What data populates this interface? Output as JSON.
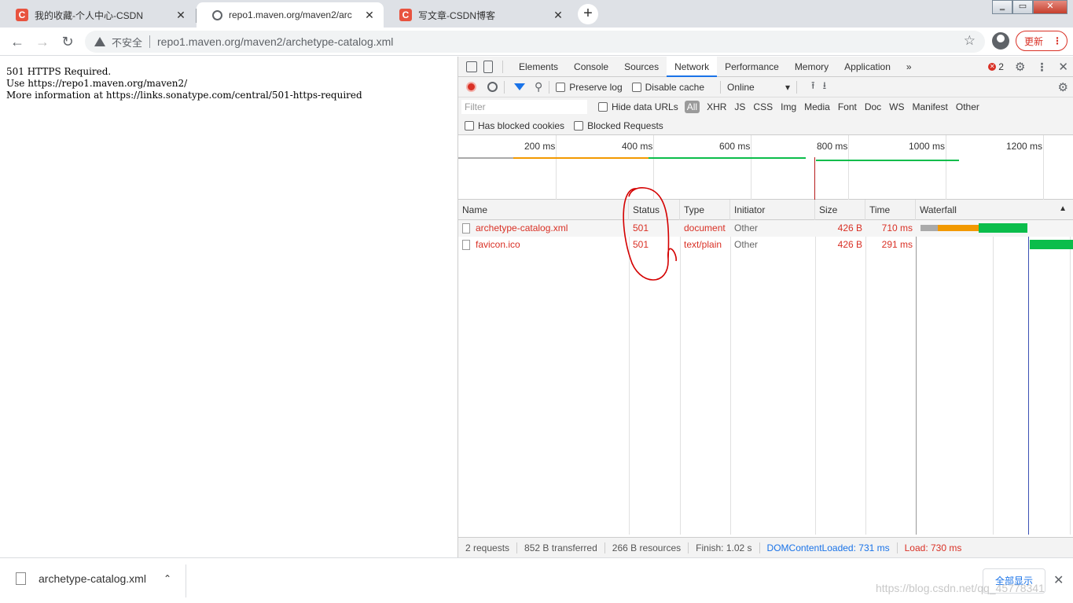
{
  "browser": {
    "tabs": [
      {
        "title": "我的收藏-个人中心-CSDN",
        "favicon": "C"
      },
      {
        "title": "repo1.maven.org/maven2/arc",
        "favicon": ""
      },
      {
        "title": "写文章-CSDN博客",
        "favicon": "C"
      }
    ],
    "new_tab": "+",
    "insecure_label": "不安全",
    "url": "repo1.maven.org/maven2/archetype-catalog.xml",
    "update_label": "更新",
    "close_glyph": "✕",
    "minimize_glyph": "‗",
    "maximize_glyph": "▭"
  },
  "page": {
    "line1": "501 HTTPS Required.",
    "line2": "Use https://repo1.maven.org/maven2/",
    "line3": "More information at https://links.sonatype.com/central/501-https-required"
  },
  "devtools": {
    "tabs": [
      "Elements",
      "Console",
      "Sources",
      "Network",
      "Performance",
      "Memory",
      "Application"
    ],
    "more": "»",
    "error_count": "2",
    "preserve_log": "Preserve log",
    "disable_cache": "Disable cache",
    "throttle": "Online",
    "filter_placeholder": "Filter",
    "hide_data_urls": "Hide data URLs",
    "types": [
      "All",
      "XHR",
      "JS",
      "CSS",
      "Img",
      "Media",
      "Font",
      "Doc",
      "WS",
      "Manifest",
      "Other"
    ],
    "has_blocked_cookies": "Has blocked cookies",
    "blocked_requests": "Blocked Requests",
    "overview_ticks": [
      "200 ms",
      "400 ms",
      "600 ms",
      "800 ms",
      "1000 ms",
      "1200 ms"
    ],
    "columns": [
      "Name",
      "Status",
      "Type",
      "Initiator",
      "Size",
      "Time",
      "Waterfall"
    ],
    "rows": [
      {
        "name": "archetype-catalog.xml",
        "status": "501",
        "type": "document",
        "initiator": "Other",
        "size": "426 B",
        "time": "710 ms"
      },
      {
        "name": "favicon.ico",
        "status": "501",
        "type": "text/plain",
        "initiator": "Other",
        "size": "426 B",
        "time": "291 ms"
      }
    ],
    "status_bar": {
      "requests": "2 requests",
      "transferred": "852 B transferred",
      "resources": "266 B resources",
      "finish": "Finish: 1.02 s",
      "dcl": "DOMContentLoaded: 731 ms",
      "load": "Load: 730 ms"
    },
    "colors": {
      "error": "#d93025",
      "accent": "#1a73e8",
      "waiting": "#f29900",
      "download": "#0bbd4b"
    }
  },
  "downloads": {
    "file": "archetype-catalog.xml",
    "show_all": "全部显示"
  },
  "watermark": "https://blog.csdn.net/qq_45778341"
}
